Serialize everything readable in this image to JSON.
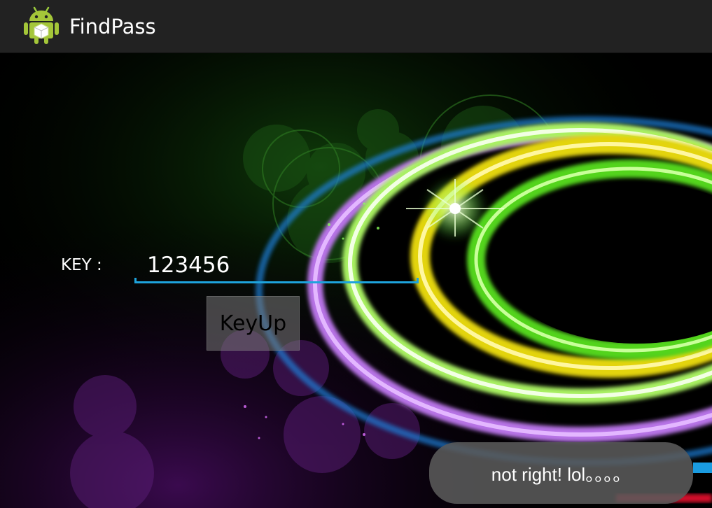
{
  "action_bar": {
    "title": "FindPass",
    "icon": "android-robot-icon",
    "background": "#222222"
  },
  "form": {
    "key_label": "KEY :",
    "key_value": "123456",
    "button_label": "KeyUp",
    "accent_color": "#1ea3dc"
  },
  "toast": {
    "message": "not right! lol。。。。"
  }
}
